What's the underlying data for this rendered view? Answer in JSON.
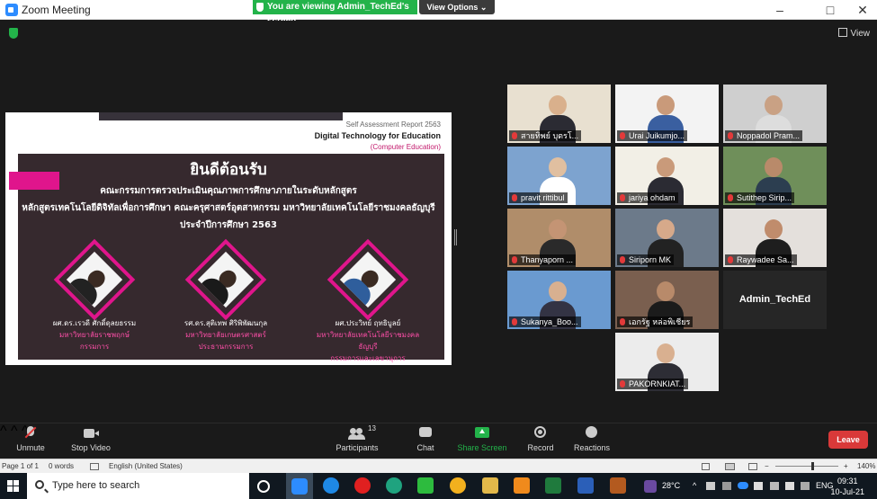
{
  "window": {
    "title": "Zoom Meeting",
    "minimize": "–",
    "maximize": "□",
    "close": "✕"
  },
  "banner": {
    "viewing": "You are viewing Admin_TechEd's screen",
    "view_options": "View Options ⌄"
  },
  "main": {
    "view_label": "View"
  },
  "slide": {
    "report": "Self Assessment Report 2563",
    "program": "Digital Technology for Education",
    "sub": "(Computer Education)",
    "welcome": "ยินดีต้อนรับ",
    "line1": "คณะกรรมการตรวจประเมินคุณภาพการศึกษาภายในระดับหลักสูตร",
    "line2": "หลักสูตรเทคโนโลยีดิจิทัลเพื่อการศึกษา คณะครุศาสตร์อุตสาหกรรม มหาวิทยาลัยเทคโนโลยีราชมงคลธัญบุรี",
    "line3": "ประจำปีการศึกษา 2563",
    "people": [
      {
        "name": "ผศ.ดร.เรวดี ศักดิ์ดุลยธรรม",
        "inst": "มหาวิทยาลัยราชพฤกษ์",
        "role": "กรรมการ"
      },
      {
        "name": "รศ.ดร.สุติเทพ ศิริพิพัฒนกุล",
        "inst": "มหาวิทยาลัยเกษตรศาสตร์",
        "role": "ประธานกรรมการ"
      },
      {
        "name": "ผศ.ประวิทย์ ฤทธิบูลย์",
        "inst": "มหาวิทยาลัยเทคโนโลยีราชมงคลธัญบุรี",
        "role": "กรรมการและเลขานุการ"
      }
    ]
  },
  "gallery": [
    {
      "name": "สายทิพย์ บุตรโ...",
      "bg": "#e8e0d0",
      "skin": "#d9b08c",
      "shirt": "#2b2b33"
    },
    {
      "name": "Urai Juikumjo...",
      "bg": "#f3f3f3",
      "skin": "#c99a7a",
      "shirt": "#3a5fa0"
    },
    {
      "name": "Noppadol Pram...",
      "bg": "#cfcfcf",
      "skin": "#c9a184",
      "shirt": "#dddddd"
    },
    {
      "name": "pravit rittibul",
      "bg": "#7da3cf",
      "skin": "#e0bfa0",
      "shirt": "#ffffff"
    },
    {
      "name": "jariya ohdam",
      "bg": "#f2efe6",
      "skin": "#c99a7a",
      "shirt": "#2b2b33"
    },
    {
      "name": "Sutithep Sirip...",
      "bg": "#6f8f5a",
      "skin": "#b98a6a",
      "shirt": "#2c3e50"
    },
    {
      "name": "Thanyaporn ...",
      "bg": "#b08d6a",
      "skin": "#c49474",
      "shirt": "#2a2a2a"
    },
    {
      "name": "Siriporn MK",
      "bg": "#6c7a8a",
      "skin": "#d6a98a",
      "shirt": "#222222"
    },
    {
      "name": "Raywadee Sa...",
      "bg": "#e4e0dc",
      "skin": "#c08c6c",
      "shirt": "#1e1e1e"
    },
    {
      "name": "Sukanya_Boo...",
      "bg": "#6a9ad0",
      "skin": "#d8b090",
      "shirt": "#333344"
    },
    {
      "name": "เอกรัฐ หล่อพิเชียร",
      "bg": "#7a5f4f",
      "skin": "#b88a6a",
      "shirt": "#1b1b1b"
    },
    {
      "name": "Admin_TechEd"
    },
    {
      "name": "PAKORNKIAT...",
      "bg": "#ececec",
      "skin": "#d9b090",
      "shirt": "#2d2d35"
    }
  ],
  "toolbar": {
    "unmute": "Unmute",
    "stop_video": "Stop Video",
    "participants": "Participants",
    "participants_count": "13",
    "chat": "Chat",
    "share_screen": "Share Screen",
    "record": "Record",
    "reactions": "Reactions",
    "leave": "Leave"
  },
  "statusbar": {
    "page": "Page 1 of 1",
    "words": "0 words",
    "language": "English (United States)",
    "zoom": "140%"
  },
  "taskbar": {
    "search_placeholder": "Type here to search",
    "temp": "28°C",
    "lang": "ENG",
    "time": "09:31",
    "date": "10-Jul-21"
  },
  "colors": {
    "zoom_blue": "#2d8cff",
    "banner_green": "#23b34a",
    "slide_pink": "#e0158c",
    "leave_red": "#d93939"
  }
}
